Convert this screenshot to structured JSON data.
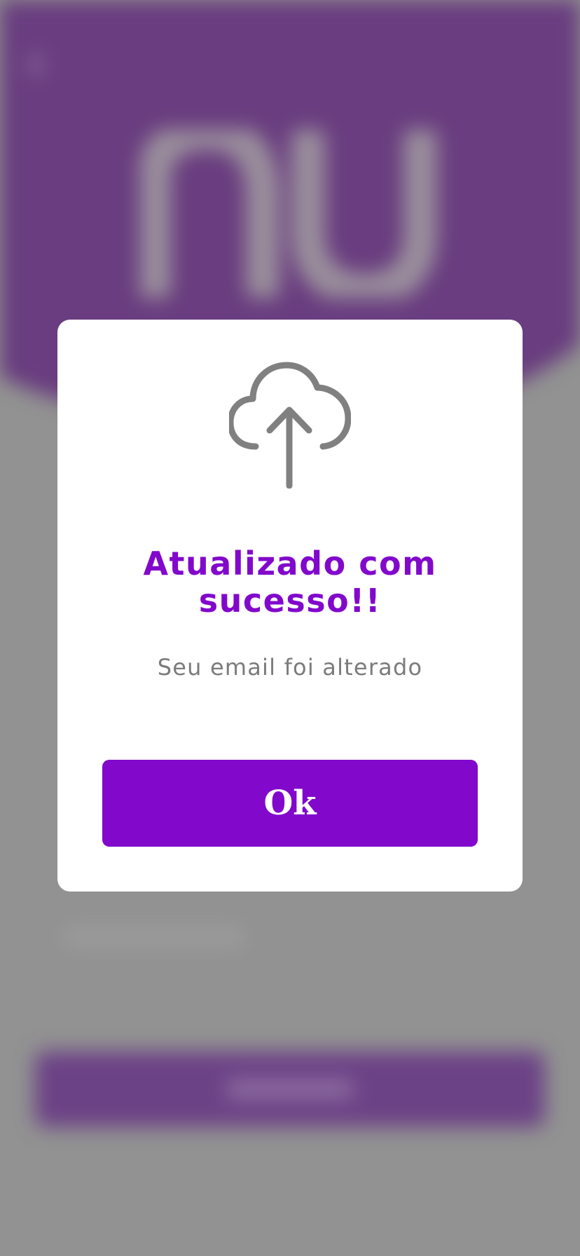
{
  "background": {
    "header_color": "#693d7f",
    "logo_icon": "nubank-logo-icon",
    "back_icon": "back-icon"
  },
  "modal": {
    "icon": "cloud-upload-icon",
    "title": "Atualizado com sucesso!!",
    "subtitle": "Seu email foi alterado",
    "ok_label": "Ok"
  },
  "colors": {
    "accent": "#8208cc",
    "overlay": "#929292",
    "icon_gray": "#808080",
    "subtitle_gray": "#7b7b7b"
  }
}
